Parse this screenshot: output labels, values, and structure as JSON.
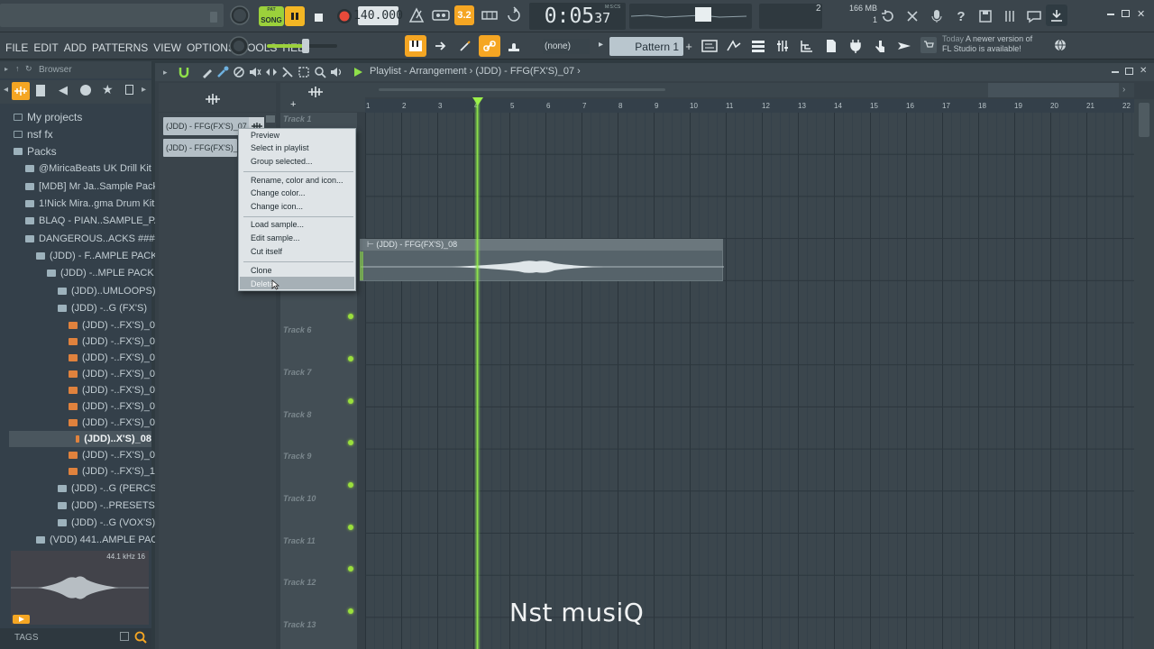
{
  "transport": {
    "mode_label": "SONG",
    "pattern_label": "PAT",
    "tempo": "140.000",
    "time_main": "0:05",
    "time_sub": "37",
    "time_unit": "M:S:CS",
    "step_value": "3.2",
    "cpu_value": "2",
    "memory": "166 MB",
    "voices": "1"
  },
  "menu": [
    "FILE",
    "EDIT",
    "ADD",
    "PATTERNS",
    "VIEW",
    "OPTIONS",
    "TOOLS",
    "HELP"
  ],
  "toolbar2": {
    "snap_value": "(none)",
    "pattern_name": "Pattern 1"
  },
  "news": {
    "label": "Today",
    "text_line1": "A newer version of",
    "text_line2": "FL Studio is available!"
  },
  "browser": {
    "title": "Browser",
    "items": [
      {
        "label": "My projects"
      },
      {
        "label": "nsf fx"
      },
      {
        "label": "Packs"
      },
      {
        "label": "@MiricaBeats UK Drill Kit"
      },
      {
        "label": "[MDB] Mr Ja..Sample Pack"
      },
      {
        "label": "1!Nick Mira..gma Drum Kit"
      },
      {
        "label": "BLAQ - PIAN..SAMPLE_PACK"
      },
      {
        "label": "DANGEROUS..ACKS ####"
      },
      {
        "label": "(JDD) - F..AMPLE PACK"
      },
      {
        "label": "(JDD) -..MPLE PACK"
      },
      {
        "label": "(JDD)..UMLOOPS)"
      },
      {
        "label": "(JDD) -..G (FX'S)"
      },
      {
        "label": "(JDD) -..FX'S)_01"
      },
      {
        "label": "(JDD) -..FX'S)_02"
      },
      {
        "label": "(JDD) -..FX'S)_03"
      },
      {
        "label": "(JDD) -..FX'S)_04"
      },
      {
        "label": "(JDD) -..FX'S)_05"
      },
      {
        "label": "(JDD) -..FX'S)_06"
      },
      {
        "label": "(JDD) -..FX'S)_07"
      },
      {
        "label": "(JDD)..X'S)_08"
      },
      {
        "label": "(JDD) -..FX'S)_09"
      },
      {
        "label": "(JDD) -..FX'S)_10"
      },
      {
        "label": "(JDD) -..G (PERCS)"
      },
      {
        "label": "(JDD) -..PRESETS)"
      },
      {
        "label": "(JDD) -..G (VOX'S)"
      },
      {
        "label": "(VDD) 441..AMPLE PACK"
      }
    ],
    "sample_info": "44.1 kHz 16",
    "tags_label": "TAGS"
  },
  "playlist": {
    "title": "Playlist - Arrangement",
    "breadcrumb_sep": "›",
    "current_pattern": "(JDD) - FFG(FX'S)_07",
    "clips": [
      "(JDD) - FFG(FX'S)_07",
      "(JDD) - FFG(FX'S)_08"
    ],
    "clip_on_track": "(JDD) - FFG(FX'S)_08",
    "tracks": [
      "Track 1",
      "Track 6",
      "Track 7",
      "Track 8",
      "Track 9",
      "Track 10",
      "Track 11",
      "Track 12",
      "Track 13"
    ],
    "ruler": [
      "1",
      "2",
      "3",
      "4",
      "5",
      "6",
      "7",
      "8",
      "9",
      "10",
      "11",
      "12",
      "13",
      "14",
      "15",
      "16",
      "17",
      "18",
      "19",
      "20",
      "21",
      "22"
    ]
  },
  "context_menu": {
    "items": [
      "Preview",
      "Select in playlist",
      "Group selected...",
      "Rename, color and icon...",
      "Change color...",
      "Change icon...",
      "Load sample...",
      "Edit sample...",
      "Cut itself",
      "Clone",
      "Delete"
    ],
    "highlighted": "Delete"
  },
  "watermark": "Nst musiQ",
  "colors": {
    "accent_green": "#9cf04a",
    "accent_orange": "#f5a623",
    "record_red": "#e84a3a"
  }
}
